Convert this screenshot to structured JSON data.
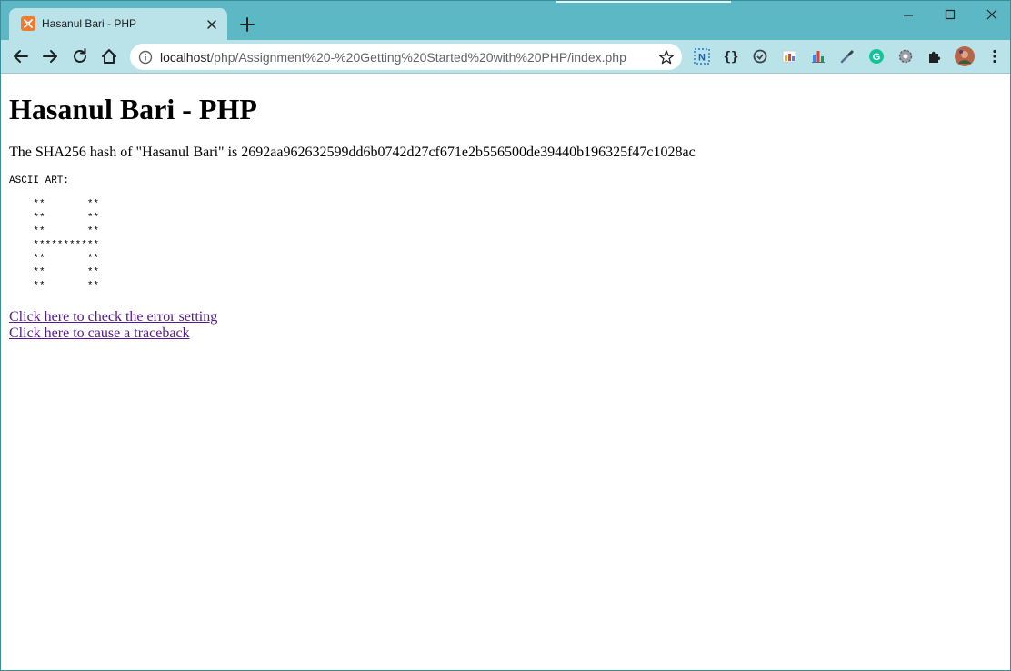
{
  "browser": {
    "tab": {
      "title": "Hasanul Bari - PHP",
      "favicon": "xampp-icon"
    },
    "address_bar": {
      "host": "localhost",
      "path": "/php/Assignment%20-%20Getting%20Started%20with%20PHP/index.php"
    },
    "extensions": [
      "notion-web-clipper-icon",
      "json-formatter-icon",
      "sync-icon",
      "color-palette-icon",
      "bar-chart-icon",
      "eyedropper-icon",
      "grammarly-icon",
      "settings-gear-icon",
      "puzzle-extensions-icon",
      "profile-avatar"
    ],
    "colors": {
      "frame": "#5bb8c4",
      "toolbar": "#b9e3e9",
      "visited_link": "#551a8b"
    }
  },
  "page": {
    "heading": "Hasanul Bari - PHP",
    "hash_line": "The SHA256 hash of \"Hasanul Bari\" is 2692aa962632599dd6b0742d27cf671e2b556500de39440b196325f47c1028ac",
    "ascii_label": "ASCII ART:",
    "ascii_art": "    **       **\n    **       **\n    **       **\n    ***********\n    **       **\n    **       **\n    **       **",
    "links": [
      {
        "text": "Click here to check the error setting"
      },
      {
        "text": "Click here to cause a traceback"
      }
    ]
  }
}
